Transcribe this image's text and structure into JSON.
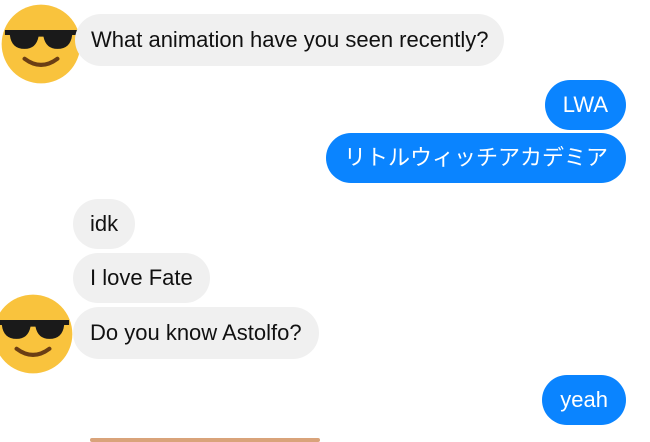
{
  "avatar_icon": "sunglasses-emoji-icon",
  "colors": {
    "incoming_bubble": "#f0f0f0",
    "outgoing_bubble": "#0a84ff",
    "outgoing_text": "#ffffff",
    "incoming_text": "#111111"
  },
  "messages": [
    {
      "sender": "them",
      "text": "What animation have you seen recently?"
    },
    {
      "sender": "me",
      "text": "LWA"
    },
    {
      "sender": "me",
      "text": "リトルウィッチアカデミア"
    },
    {
      "sender": "them",
      "text": "idk"
    },
    {
      "sender": "them",
      "text": "I love Fate"
    },
    {
      "sender": "them",
      "text": "Do you know  Astolfo?"
    },
    {
      "sender": "me",
      "text": "yeah"
    }
  ]
}
